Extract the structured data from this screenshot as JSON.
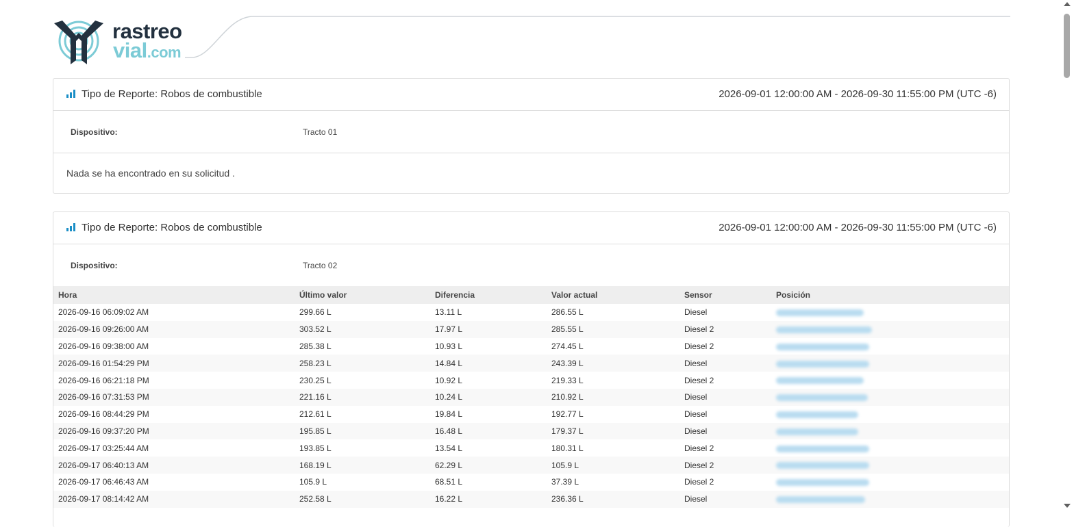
{
  "logo": {
    "line1": "rastreo",
    "line2": "vial",
    "line3": ".com"
  },
  "icons": {
    "report": "bar-chart-icon"
  },
  "colors": {
    "accent": "#1a8ec6",
    "logo_dark": "#23313f",
    "logo_light": "#7ccbd6"
  },
  "reports": [
    {
      "type_label": "Tipo de Reporte: Robos de combustible",
      "range": "2026-09-01 12:00:00 AM - 2026-09-30 11:55:00 PM (UTC -6)",
      "device_label": "Dispositivo:",
      "device": "Tracto 01",
      "message": "Nada se ha encontrado en su solicitud ."
    },
    {
      "type_label": "Tipo de Reporte: Robos de combustible",
      "range": "2026-09-01 12:00:00 AM - 2026-09-30 11:55:00 PM (UTC -6)",
      "device_label": "Dispositivo:",
      "device": "Tracto 02",
      "columns": [
        "Hora",
        "Último valor",
        "Diferencia",
        "Valor actual",
        "Sensor",
        "Posición"
      ],
      "rows": [
        [
          "2026-09-16 06:09:02 AM",
          "299.66 L",
          "13.11 L",
          "286.55 L",
          "Diesel"
        ],
        [
          "2026-09-16 09:26:00 AM",
          "303.52 L",
          "17.97 L",
          "285.55 L",
          "Diesel 2"
        ],
        [
          "2026-09-16 09:38:00 AM",
          "285.38 L",
          "10.93 L",
          "274.45 L",
          "Diesel 2"
        ],
        [
          "2026-09-16 01:54:29 PM",
          "258.23 L",
          "14.84 L",
          "243.39 L",
          "Diesel"
        ],
        [
          "2026-09-16 06:21:18 PM",
          "230.25 L",
          "10.92 L",
          "219.33 L",
          "Diesel 2"
        ],
        [
          "2026-09-16 07:31:53 PM",
          "221.16 L",
          "10.24 L",
          "210.92 L",
          "Diesel"
        ],
        [
          "2026-09-16 08:44:29 PM",
          "212.61 L",
          "19.84 L",
          "192.77 L",
          "Diesel"
        ],
        [
          "2026-09-16 09:37:20 PM",
          "195.85 L",
          "16.48 L",
          "179.37 L",
          "Diesel"
        ],
        [
          "2026-09-17 03:25:44 AM",
          "193.85 L",
          "13.54 L",
          "180.31 L",
          "Diesel 2"
        ],
        [
          "2026-09-17 06:40:13 AM",
          "168.19 L",
          "62.29 L",
          "105.9 L",
          "Diesel 2"
        ],
        [
          "2026-09-17 06:46:43 AM",
          "105.9 L",
          "68.51 L",
          "37.39 L",
          "Diesel 2"
        ],
        [
          "2026-09-17 08:14:42 AM",
          "252.58 L",
          "16.22 L",
          "236.36 L",
          "Diesel"
        ]
      ]
    }
  ]
}
